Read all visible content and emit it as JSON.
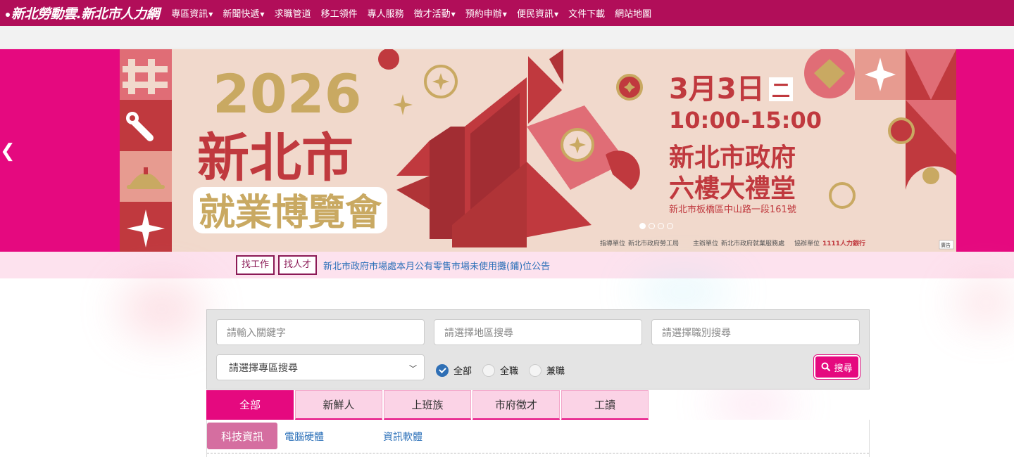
{
  "site": {
    "logo": "新北勞動雲.新北市人力網"
  },
  "nav": {
    "items": [
      {
        "label": "專區資訊",
        "caret": true
      },
      {
        "label": "新聞快遞",
        "caret": true
      },
      {
        "label": "求職管道",
        "caret": false
      },
      {
        "label": "移工領件",
        "caret": false
      },
      {
        "label": "專人服務",
        "caret": false
      },
      {
        "label": "徵才活動",
        "caret": true
      },
      {
        "label": "預約申辦",
        "caret": true
      },
      {
        "label": "便民資訊",
        "caret": true
      },
      {
        "label": "文件下載",
        "caret": false
      },
      {
        "label": "網站地圖",
        "caret": false
      }
    ]
  },
  "banner": {
    "year": "2026",
    "title_line1": "新北市",
    "title_line2": "就業博覽會",
    "date": "3月3日",
    "weekday": "二",
    "time": "10:00-15:00",
    "venue_line1": "新北市政府",
    "venue_line2": "六樓大禮堂",
    "address": "新北市板橋區中山路一段161號",
    "credits": {
      "guide_label": "指導單位",
      "guide_org": "新北市政府勞工局",
      "host_label": "主辦單位",
      "host_org": "新北市政府就業服務處",
      "co_label": "協辦單位",
      "co_org": "1111人力銀行"
    },
    "ad_badge": "廣告",
    "slides": 4,
    "active_slide": 1
  },
  "ticker": {
    "find_job": "找工作",
    "find_talent": "找人才",
    "headline": "新北市政府市場處本月公有零售市場未使用攤(鋪)位公告"
  },
  "search": {
    "keyword_placeholder": "請輸入關鍵字",
    "area_placeholder": "請選擇地區搜尋",
    "job_type_placeholder": "請選擇職別搜尋",
    "zone_select": "請選擇專區搜尋",
    "radios": [
      {
        "label": "全部",
        "checked": true
      },
      {
        "label": "全職",
        "checked": false
      },
      {
        "label": "兼職",
        "checked": false
      }
    ],
    "button_label": "搜尋"
  },
  "tabs": [
    {
      "label": "全部",
      "active": true
    },
    {
      "label": "新鮮人",
      "active": false
    },
    {
      "label": "上班族",
      "active": false
    },
    {
      "label": "市府徵才",
      "active": false
    },
    {
      "label": "工讀",
      "active": false
    }
  ],
  "subcategories": {
    "active": "科技資訊",
    "items": [
      "電腦硬體",
      "資訊軟體"
    ]
  },
  "colors": {
    "nav_bg": "#b10e59",
    "accent": "#e5097f",
    "banner_bg": "#f1d9cc",
    "banner_red": "#c0393e",
    "banner_gold": "#c9a962",
    "ticker_bg": "#fde2ee",
    "link_blue": "#2a6fb8"
  }
}
